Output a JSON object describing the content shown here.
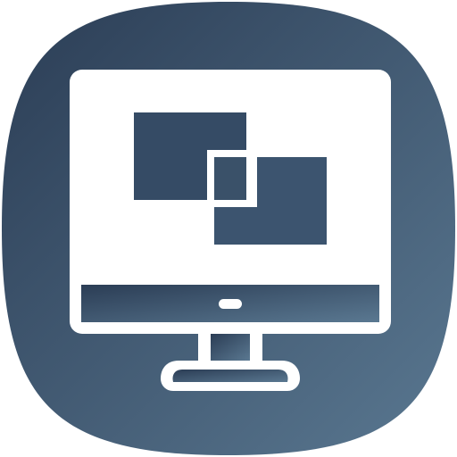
{
  "app_icon": {
    "icon": "monitor-with-overlapping-windows-icon",
    "colors": {
      "gradient_start": "#2b3d55",
      "gradient_end": "#5a7891",
      "foreground": "#ffffff"
    }
  }
}
